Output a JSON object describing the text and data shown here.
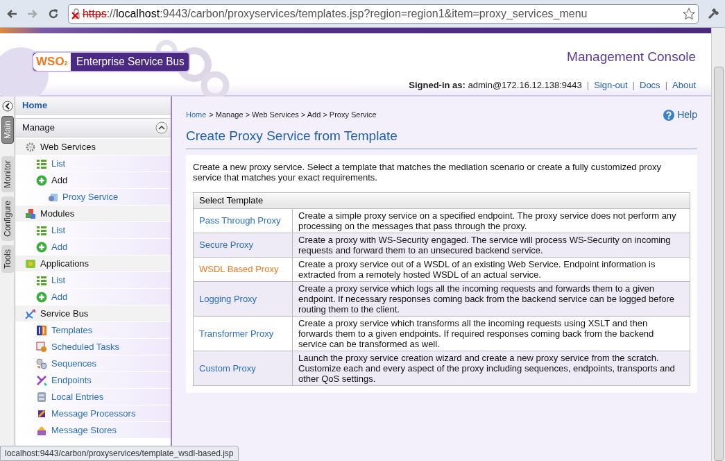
{
  "browser": {
    "url_scheme": "https",
    "url_separator": "://",
    "url_host": "localhost",
    "url_rest": ":9443/carbon/proxyservices/templates.jsp?region=region1&item=proxy_services_menu",
    "status_url": "localhost:9443/carbon/proxyservices/template_wsdl-based.jsp"
  },
  "header": {
    "logo_mark": "WSO",
    "logo_sub": "2",
    "logo_text": "Enterprise Service Bus",
    "console_title": "Management Console",
    "signed_in_label": "Signed-in as:",
    "user": "admin@172.16.12.138:9443",
    "separator": "|",
    "links": [
      "Sign-out",
      "Docs",
      "About"
    ]
  },
  "side_tabs": [
    {
      "label": "Main",
      "selected": true
    },
    {
      "label": "Monitor",
      "selected": false
    },
    {
      "label": "Configure",
      "selected": false
    },
    {
      "label": "Tools",
      "selected": false
    }
  ],
  "sidebar": {
    "home": "Home",
    "section": "Manage",
    "section_expanded": true,
    "items": [
      {
        "label": "Web Services",
        "kind": "group",
        "children": [
          {
            "label": "List",
            "kind": "list"
          },
          {
            "label": "Add",
            "kind": "add",
            "expanded": true,
            "children": [
              {
                "label": "Proxy Service",
                "kind": "item"
              }
            ]
          }
        ]
      },
      {
        "label": "Modules",
        "kind": "group",
        "children": [
          {
            "label": "List",
            "kind": "list"
          },
          {
            "label": "Add",
            "kind": "add",
            "expanded": false
          }
        ]
      },
      {
        "label": "Applications",
        "kind": "group",
        "children": [
          {
            "label": "List",
            "kind": "list"
          },
          {
            "label": "Add",
            "kind": "add",
            "expanded": false
          }
        ]
      },
      {
        "label": "Service Bus",
        "kind": "group",
        "children": [
          {
            "label": "Templates",
            "kind": "item"
          },
          {
            "label": "Scheduled Tasks",
            "kind": "item"
          },
          {
            "label": "Sequences",
            "kind": "item"
          },
          {
            "label": "Endpoints",
            "kind": "item"
          },
          {
            "label": "Local Entries",
            "kind": "item"
          },
          {
            "label": "Message Processors",
            "kind": "item"
          },
          {
            "label": "Message Stores",
            "kind": "item"
          }
        ]
      }
    ]
  },
  "breadcrumb": [
    {
      "label": "Home",
      "kind": "link"
    },
    {
      "label": "> Manage > Web Services > Add > Proxy Service",
      "kind": "text"
    }
  ],
  "help": "Help",
  "page_title": "Create Proxy Service from Template",
  "intro": "Create a new proxy service. Select a template that matches the mediation scenario or create a fully customized proxy service that matches your exact requirements.",
  "table": {
    "heading": "Select Template",
    "rows": [
      {
        "name": "Pass Through Proxy",
        "hovered": false,
        "description": "Create a simple proxy service on a specified endpoint. The proxy service does not perform any processing on the messages that pass through the proxy."
      },
      {
        "name": "Secure Proxy",
        "hovered": false,
        "description": "Create a proxy with WS-Security engaged. The service will process WS-Security on incoming requests and forward them to an unsecured backend service."
      },
      {
        "name": "WSDL Based Proxy",
        "hovered": true,
        "description": "Create a proxy service out of a WSDL of an existing Web Service. Endpoint information is extracted from a remotely hosted WSDL of an actual service."
      },
      {
        "name": "Logging Proxy",
        "hovered": false,
        "description": "Create a proxy service which logs all the incoming requests and forwards them to a given endpoint. If necessary responses coming back from the backend service can be logged before routing them to the client."
      },
      {
        "name": "Transformer Proxy",
        "hovered": false,
        "description": "Create a proxy service which transforms all the incoming requests using XSLT and then forwards them to a given endpoints. If required responses coming back from the backend service can be transformed as well."
      },
      {
        "name": "Custom Proxy",
        "hovered": false,
        "description": "Launch the proxy service creation wizard and create a new proxy service from the scratch. Customize each and every aspect of the proxy including sequences, endpoints, transports and other QoS settings."
      }
    ]
  }
}
